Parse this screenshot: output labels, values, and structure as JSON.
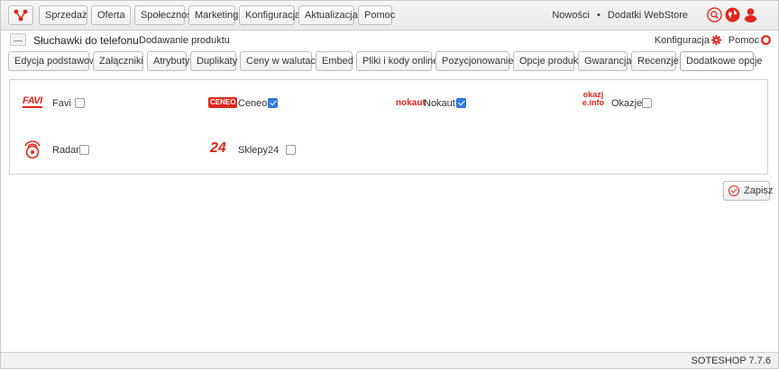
{
  "nav": {
    "items": [
      "Sprzedaż",
      "Oferta",
      "Społeczność",
      "Marketing",
      "Konfiguracja",
      "Aktualizacja",
      "Pomoc"
    ],
    "news": "Nowości",
    "separator": "•",
    "addons": "Dodatki WebStore"
  },
  "header": {
    "product": "Słuchawki do telefonu",
    "separator": "▸",
    "page": "Dodawanie produktu",
    "config": "Konfiguracja",
    "help": "Pomoc"
  },
  "tabs": [
    "Edycja podstawowa",
    "Załączniki",
    "Atrybuty",
    "Duplikaty",
    "Ceny w walutach",
    "Embed",
    "Pliki i kody online",
    "Pozycjonowanie",
    "Opcje produktu",
    "Gwarancja",
    "Recenzje",
    "Dodatkowe opcje"
  ],
  "active_tab": "Dodatkowe opcje",
  "options": [
    {
      "label": "Favi",
      "logo_text": "FAVI",
      "checked": false
    },
    {
      "label": "Ceneo",
      "logo_text": "CENEO",
      "checked": true
    },
    {
      "label": "Nokaut",
      "logo_text": "nokaut",
      "checked": true
    },
    {
      "label": "Okazje",
      "logo_text": "okazje.info",
      "checked": false
    },
    {
      "label": "Radar",
      "logo_text": "",
      "checked": false
    },
    {
      "label": "Sklepy24",
      "logo_text": "24",
      "checked": false
    }
  ],
  "save_label": "Zapisz",
  "version": "SOTESHOP 7.7.6",
  "colors": {
    "accent": "#e1261c",
    "checkbox": "#2f7fe3"
  }
}
